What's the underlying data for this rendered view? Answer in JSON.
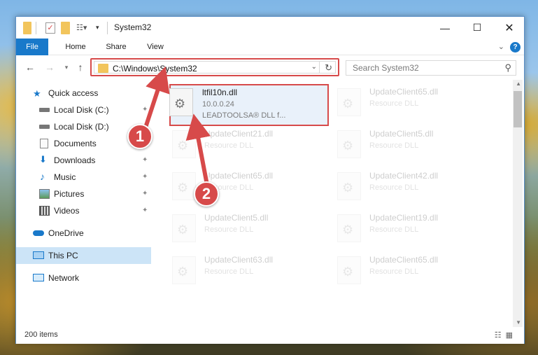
{
  "window": {
    "title": "System32"
  },
  "ribbon": {
    "tabs": [
      "File",
      "Home",
      "Share",
      "View"
    ],
    "help": "?"
  },
  "nav": {
    "address": "C:\\Windows\\System32",
    "search_placeholder": "Search System32"
  },
  "sidebar": {
    "items": [
      {
        "label": "Quick access",
        "icon": "star-icon"
      },
      {
        "label": "Local Disk (C:)",
        "icon": "drive-icon",
        "pinned": true
      },
      {
        "label": "Local Disk (D:)",
        "icon": "drive-icon",
        "pinned": false
      },
      {
        "label": "Documents",
        "icon": "documents-icon",
        "pinned": true
      },
      {
        "label": "Downloads",
        "icon": "downloads-icon",
        "pinned": true
      },
      {
        "label": "Music",
        "icon": "music-icon",
        "pinned": true
      },
      {
        "label": "Pictures",
        "icon": "pictures-icon",
        "pinned": true
      },
      {
        "label": "Videos",
        "icon": "videos-icon",
        "pinned": true
      },
      {
        "label": "OneDrive",
        "icon": "onedrive-icon"
      },
      {
        "label": "This PC",
        "icon": "pc-icon",
        "selected": true
      },
      {
        "label": "Network",
        "icon": "network-icon"
      }
    ]
  },
  "files": {
    "highlighted": {
      "name": "ltfil10n.dll",
      "version": "10.0.0.24",
      "description": "LEADTOOLSA® DLL f..."
    },
    "faded": [
      {
        "name": "UpdateClient65.dll",
        "type": "Resource DLL"
      },
      {
        "name": "UpdateClient21.dll",
        "type": "Resource DLL"
      },
      {
        "name": "UpdateClient5.dll",
        "type": "Resource DLL"
      },
      {
        "name": "UpdateClient65.dll",
        "type": "Resource DLL"
      },
      {
        "name": "UpdateClient42.dll",
        "type": "Resource DLL"
      },
      {
        "name": "UpdateClient5.dll",
        "type": "Resource DLL"
      },
      {
        "name": "UpdateClient19.dll",
        "type": "Resource DLL"
      },
      {
        "name": "UpdateClient63.dll",
        "type": "Resource DLL"
      },
      {
        "name": "UpdateClient65.dll",
        "type": "Resource DLL"
      }
    ]
  },
  "status": {
    "count": "200 items"
  },
  "callouts": [
    "1",
    "2"
  ],
  "colors": {
    "accent": "#1979ca",
    "annotation": "#d74a4a",
    "selected": "#cce4f7"
  }
}
